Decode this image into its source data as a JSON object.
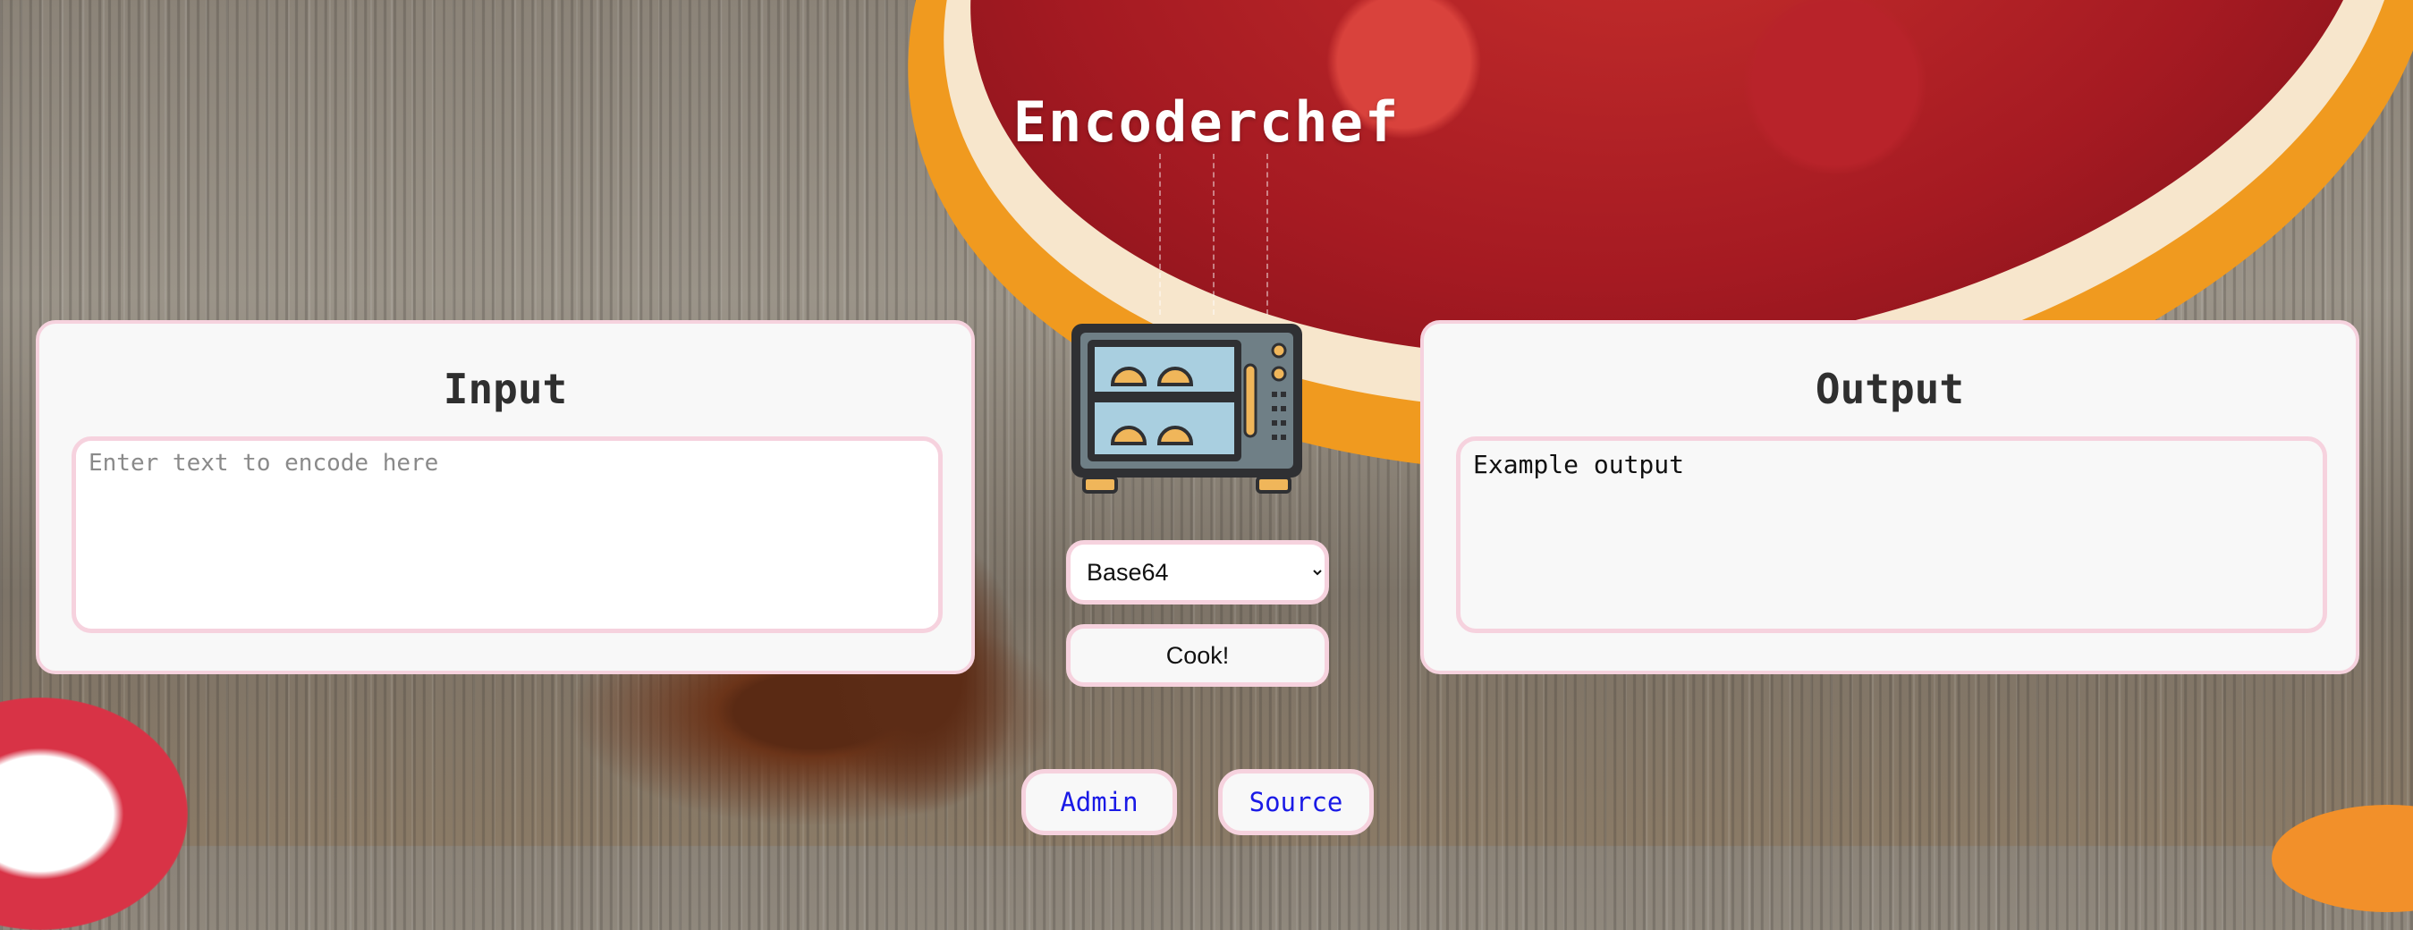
{
  "app": {
    "title": "Encoderchef"
  },
  "input_panel": {
    "heading": "Input",
    "placeholder": "Enter text to encode here",
    "value": ""
  },
  "output_panel": {
    "heading": "Output",
    "value": "Example output"
  },
  "controls": {
    "encoding_selected": "Base64",
    "cook_label": "Cook!",
    "oven_icon": "oven-icon"
  },
  "nav": {
    "admin_label": "Admin",
    "source_label": "Source"
  },
  "colors": {
    "panel_border": "#f6d2de",
    "link": "#1a1ae6",
    "title": "#ffffff"
  }
}
